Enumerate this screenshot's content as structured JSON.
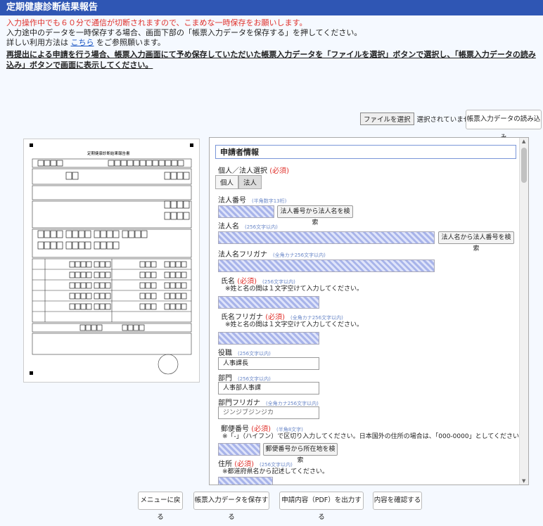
{
  "header": {
    "title": "定期健康診断結果報告"
  },
  "notices": {
    "line1": "入力操作中でも６０分で通信が切断されますので、こまめな一時保存をお願いします。",
    "line2": "入力途中のデータを一時保存する場合、画面下部の「帳票入力データを保存する」を押してください。",
    "line3_pre": "詳しい利用方法は ",
    "line3_link": "こちら",
    "line3_post": " をご参照願います。",
    "line4": "再提出による申請を行う場合、帳票入力画面にて予め保存していただいた帳票入力データを「ファイルを選択」ボタンで選択し、「帳票入力データの読み込み」ボタンで画面に表示してください。"
  },
  "file": {
    "choose_label": "ファイルを選択",
    "status": "選択されていません",
    "load_label": "帳票入力データの読み込み"
  },
  "form_preview": {
    "title": "定期健康診断結果報告書"
  },
  "panel": {
    "section_title": "申請者情報",
    "entity_label": "個人／法人選択",
    "required": "(必須)",
    "opt_individual": "個人",
    "opt_corp": "法人",
    "corp_no_label": "法人番号",
    "corp_no_hint": "(半角数字13桁)",
    "corp_no_btn": "法人番号から法人名を検索",
    "corp_name_label": "法人名",
    "corp_name_hint": "(256文字以内)",
    "corp_name_btn": "法人名から法人番号を検索",
    "corp_kana_label": "法人名フリガナ",
    "corp_kana_hint": "(全角カナ256文字以内)",
    "name_label": "氏名",
    "name_hint": "(256文字以内)",
    "name_note": "※姓と名の間は１文字空けて入力してください。",
    "name_kana_label": "氏名フリガナ",
    "name_kana_hint": "(全角カナ256文字以内)",
    "name_kana_note": "※姓と名の間は１文字空けて入力してください。",
    "title_label": "役職",
    "title_hint": "(256文字以内)",
    "title_value": "人事課長",
    "dept_label": "部門",
    "dept_hint": "(256文字以内)",
    "dept_value": "人事部人事課",
    "dept_kana_label": "部門フリガナ",
    "dept_kana_hint": "(全角カナ256文字以内)",
    "dept_kana_value": "ジンジブジンジカ",
    "zip_label": "郵便番号",
    "zip_hint": "(半角8文字)",
    "zip_note": "※「-」（ハイフン）で区切り入力してください。日本国外の住所の場合は、「000-0000」としてください。",
    "zip_btn": "郵便番号から所在地を検索",
    "addr_label": "住所",
    "addr_hint": "(256文字以内)",
    "addr_note": "※都道府県名から記述してください。"
  },
  "bottom": {
    "menu": "メニューに戻る",
    "save": "帳票入力データを保存する",
    "pdf": "申請内容（PDF）を出力する",
    "confirm": "内容を確認する"
  }
}
